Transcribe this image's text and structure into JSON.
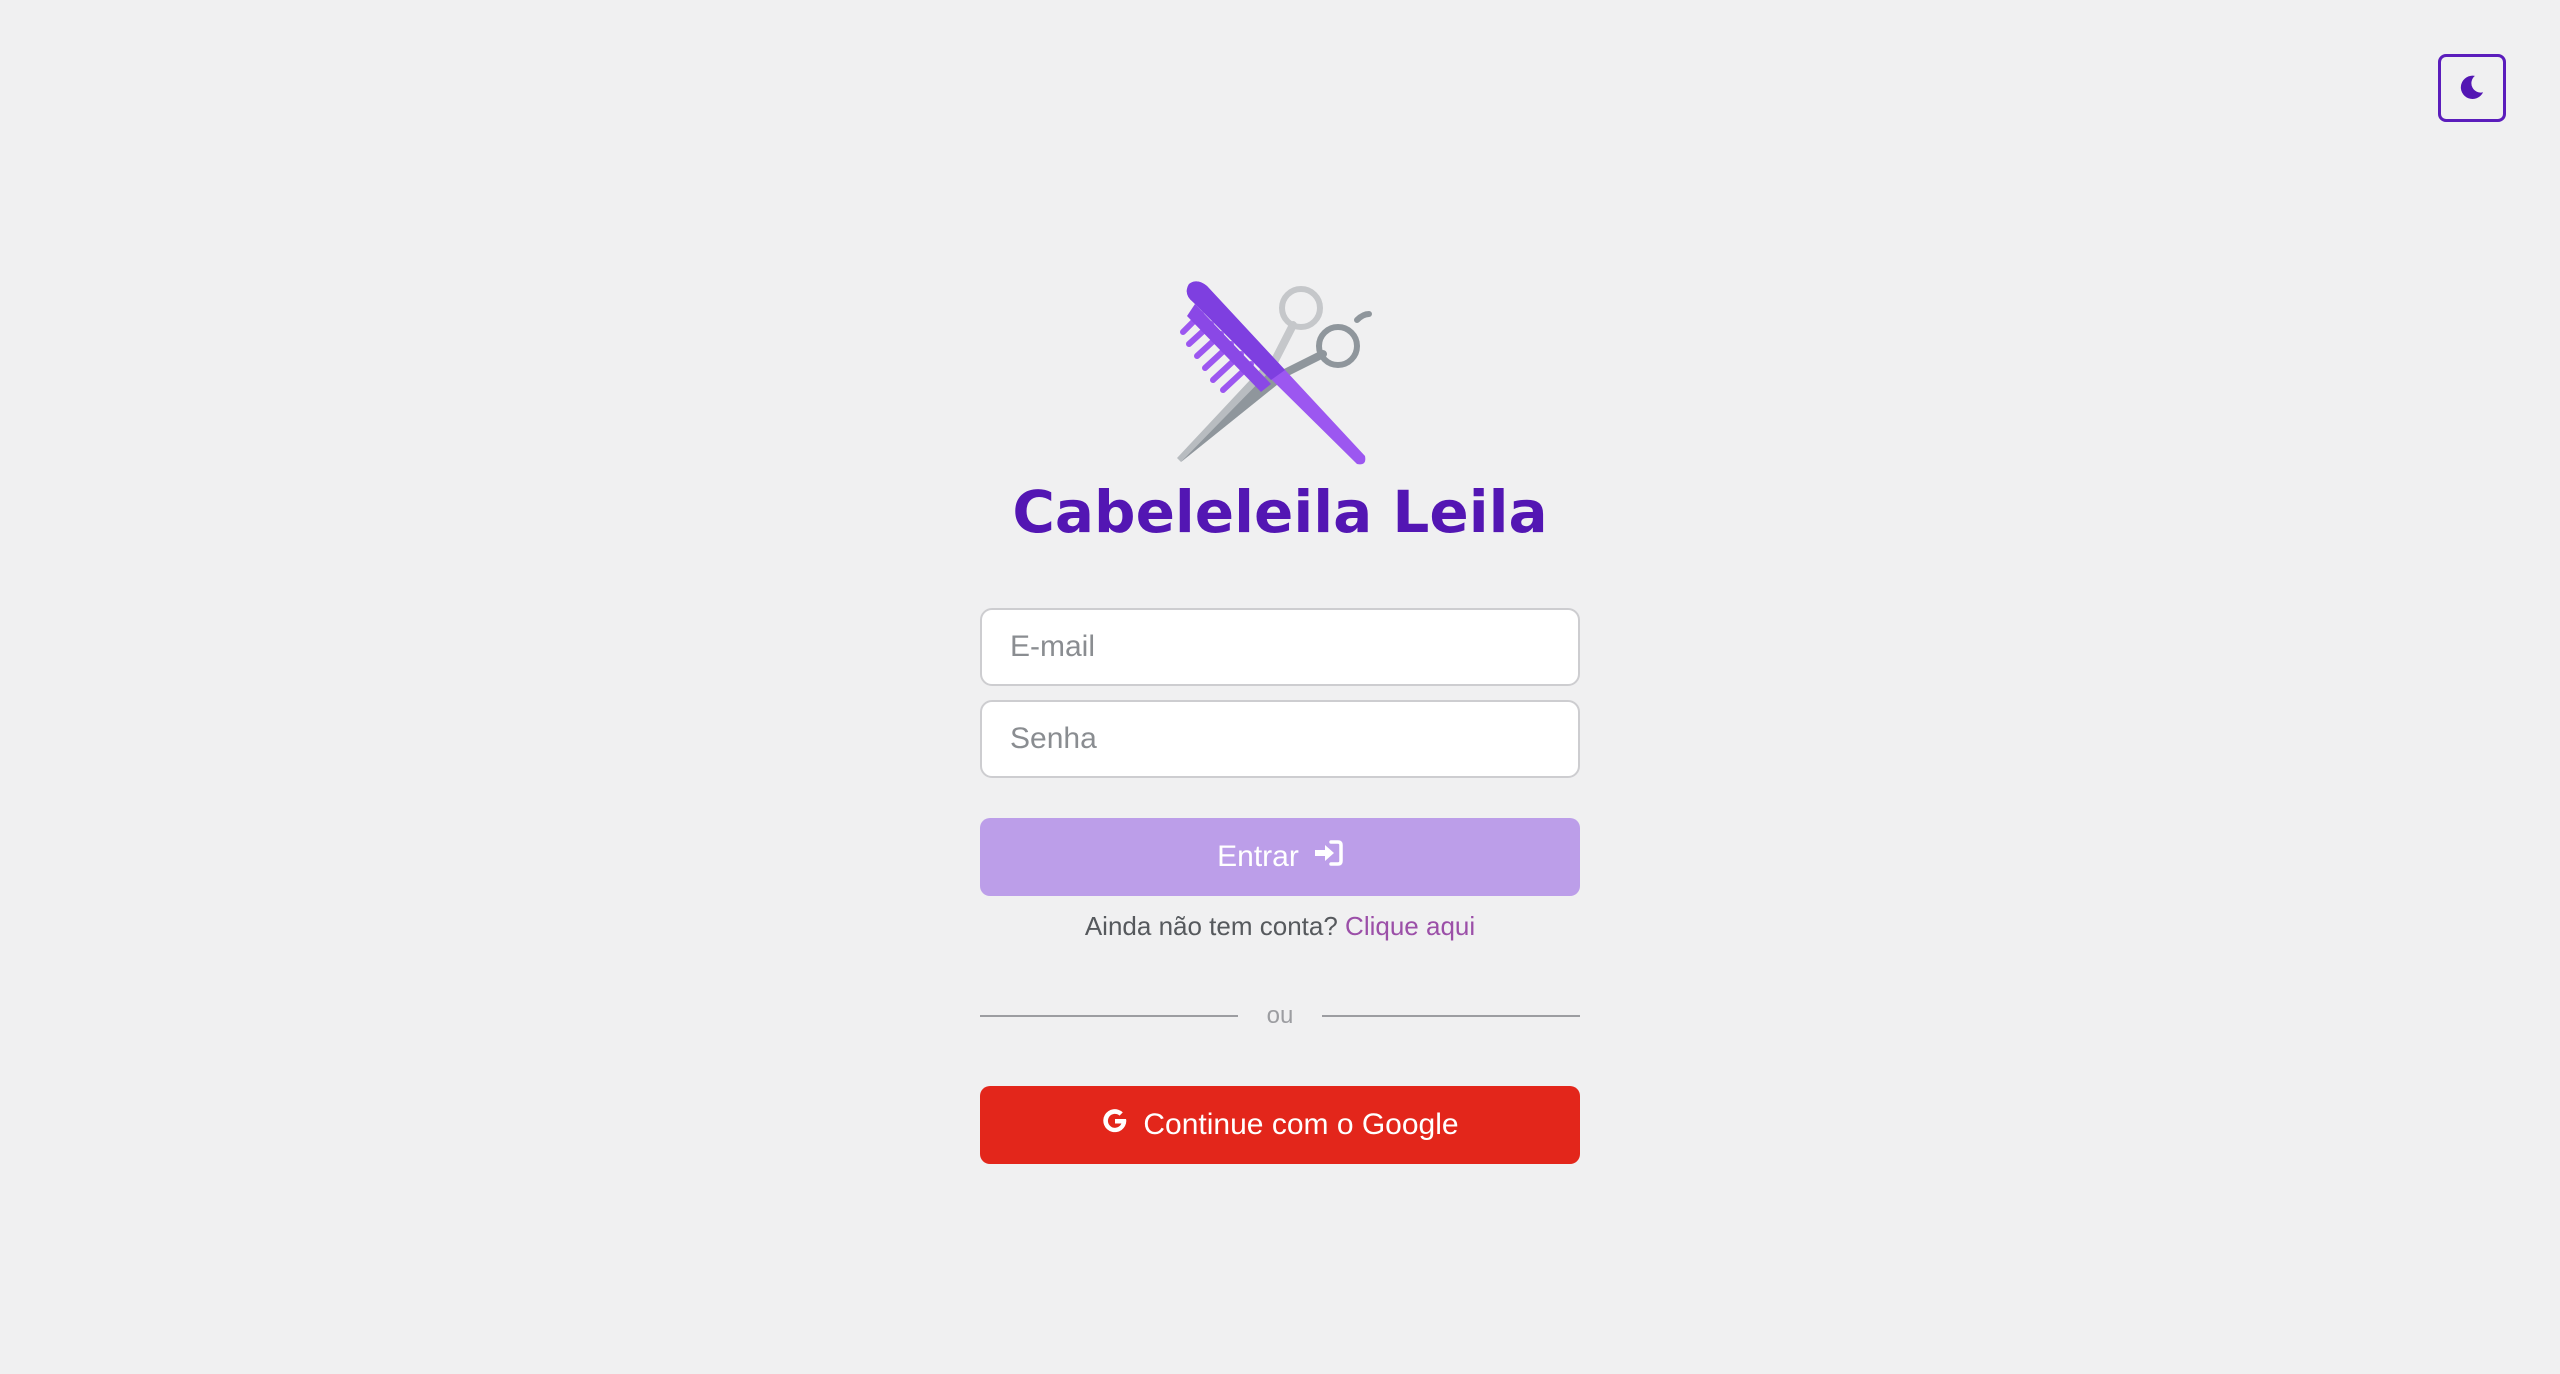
{
  "brand": {
    "title": "Cabeleleila Leila",
    "logo_icon": "comb-and-scissors-icon"
  },
  "theme_toggle": {
    "icon": "moon-icon"
  },
  "login_form": {
    "email_placeholder": "E-mail",
    "password_placeholder": "Senha",
    "submit_label": "Entrar",
    "submit_icon": "sign-in-icon"
  },
  "signup": {
    "prompt": "Ainda não tem conta?",
    "link_label": "Clique aqui"
  },
  "divider": {
    "label": "ou"
  },
  "google_button": {
    "label": "Continue com o Google",
    "icon": "google-icon"
  },
  "colors": {
    "background": "#f0f0f1",
    "brand_purple": "#5316b3",
    "login_button": "#bc9ee9",
    "google_button": "#e3261b",
    "link": "#9b4fa8"
  }
}
